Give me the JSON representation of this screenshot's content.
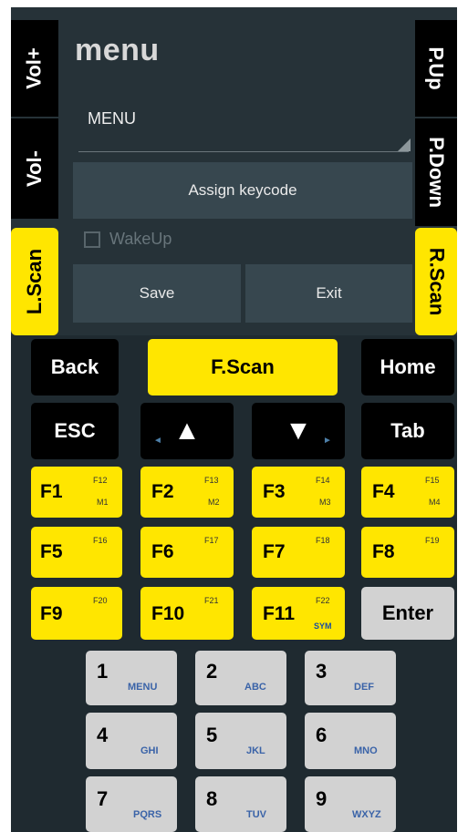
{
  "side_buttons": {
    "vol_up": "Vol+",
    "vol_down": "Vol-",
    "l_scan": "L.Scan",
    "p_up": "P.Up",
    "p_down": "P.Down",
    "r_scan": "R.Scan"
  },
  "panel": {
    "title": "menu",
    "menu_label": "MENU",
    "assign_keycode": "Assign keycode",
    "wakeup_label": "WakeUp",
    "wakeup_checked": false,
    "save": "Save",
    "exit": "Exit"
  },
  "nav_keys": {
    "back": "Back",
    "fscan": "F.Scan",
    "home": "Home",
    "esc": "ESC",
    "up": "▲",
    "down": "▼",
    "left_small": "◄",
    "right_small": "►",
    "tab": "Tab"
  },
  "fkeys": [
    {
      "main": "F1",
      "top": "F12",
      "bottom": "M1"
    },
    {
      "main": "F2",
      "top": "F13",
      "bottom": "M2"
    },
    {
      "main": "F3",
      "top": "F14",
      "bottom": "M3"
    },
    {
      "main": "F4",
      "top": "F15",
      "bottom": "M4"
    },
    {
      "main": "F5",
      "top": "F16",
      "bottom": ""
    },
    {
      "main": "F6",
      "top": "F17",
      "bottom": ""
    },
    {
      "main": "F7",
      "top": "F18",
      "bottom": ""
    },
    {
      "main": "F8",
      "top": "F19",
      "bottom": ""
    },
    {
      "main": "F9",
      "top": "F20",
      "bottom": ""
    },
    {
      "main": "F10",
      "top": "F21",
      "bottom": ""
    },
    {
      "main": "F11",
      "top": "F22",
      "bottom": "SYM"
    }
  ],
  "enter": "Enter",
  "numkeys": [
    {
      "num": "1",
      "letters": "MENU"
    },
    {
      "num": "2",
      "letters": "ABC"
    },
    {
      "num": "3",
      "letters": "DEF"
    },
    {
      "num": "4",
      "letters": "GHI"
    },
    {
      "num": "5",
      "letters": "JKL"
    },
    {
      "num": "6",
      "letters": "MNO"
    },
    {
      "num": "7",
      "letters": "PQRS"
    },
    {
      "num": "8",
      "letters": "TUV"
    },
    {
      "num": "9",
      "letters": "WXYZ"
    }
  ]
}
